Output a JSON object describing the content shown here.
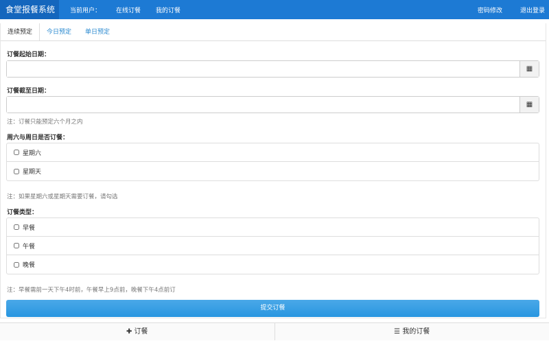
{
  "nav": {
    "brand": "食堂报餐系统",
    "current_user": "当前用户：",
    "online_order": "在线订餐",
    "my_orders": "我的订餐",
    "change_password": "密码修改",
    "logout": "退出登录"
  },
  "tabs": [
    "连续预定",
    "今日预定",
    "单日预定"
  ],
  "form": {
    "start_label": "订餐起始日期：",
    "start_value": "",
    "end_label": "订餐截至日期：",
    "end_value": "",
    "date_note": "注：订餐只能预定六个月之内",
    "weekend_label": "周六与周日是否订餐：",
    "weekend_options": [
      "星期六",
      "星期天"
    ],
    "weekend_note": "注：如果星期六或星期天需要订餐，请勾选",
    "type_label": "订餐类型：",
    "type_options": [
      "早餐",
      "午餐",
      "晚餐"
    ],
    "type_note": "注：早餐需前一天下午4时前，午餐早上9点前，晚餐下午4点前订",
    "submit": "提交订餐"
  },
  "footer": {
    "order": "订餐",
    "my_orders": "我的订餐"
  }
}
